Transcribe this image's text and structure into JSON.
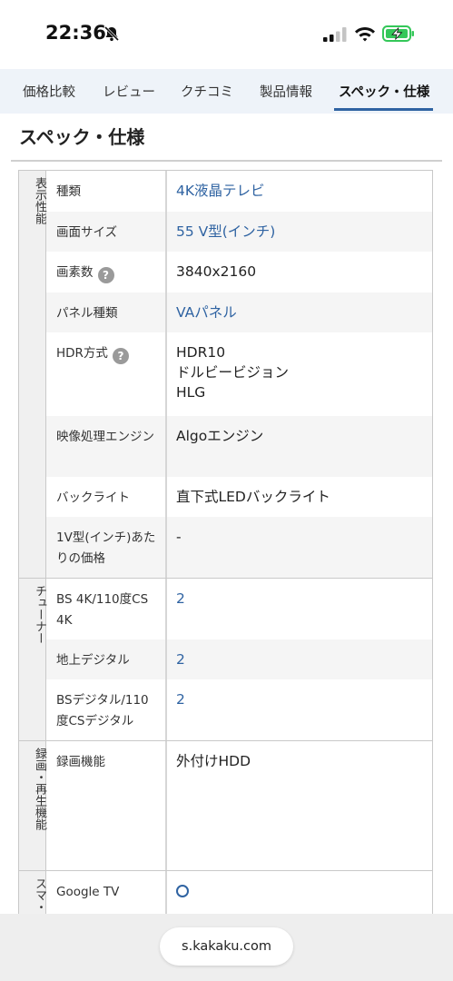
{
  "status": {
    "time": "22:36"
  },
  "tabs": [
    "価格比較",
    "レビュー",
    "クチコミ",
    "製品情報",
    "スペック・仕様"
  ],
  "section_title": "スペック・仕様",
  "groups": [
    {
      "label": "表示性能",
      "rows": [
        {
          "label": "種類",
          "value": "4K液晶テレビ",
          "link": true
        },
        {
          "label": "画面サイズ",
          "value": "55 V型(インチ)",
          "link": true
        },
        {
          "label": "画素数",
          "value": "3840x2160",
          "help": true
        },
        {
          "label": "パネル種類",
          "value": "VAパネル",
          "link": true
        },
        {
          "label": "HDR方式",
          "value": "HDR10\nドルビービジョン\nHLG",
          "help": true
        },
        {
          "label": "映像処理エンジン",
          "value": "Algoエンジン"
        },
        {
          "label": "バックライト",
          "value": "直下式LEDバックライト"
        },
        {
          "label": "1V型(インチ)あたりの価格",
          "value": "-"
        }
      ]
    },
    {
      "label": "チューナー",
      "rows": [
        {
          "label": "BS 4K/110度CS 4K",
          "value": "2",
          "link": true
        },
        {
          "label": "地上デジタル",
          "value": "2",
          "link": true
        },
        {
          "label": "BSデジタル/110度CSデジタル",
          "value": "2",
          "link": true
        }
      ]
    },
    {
      "label": "録画・再生機能",
      "rows": [
        {
          "label": "録画機能",
          "value": "外付けHDD"
        }
      ]
    },
    {
      "label": "スマ・",
      "rows": [
        {
          "label": "Google TV",
          "value": "○",
          "link": true
        }
      ]
    }
  ],
  "help_glyph": "?",
  "bottom_bar": {
    "url": "s.kakaku.com"
  },
  "colors": {
    "link": "#2f63a2",
    "tab_bar": "#eef3f9",
    "accent_underline": "#2f63a2"
  }
}
